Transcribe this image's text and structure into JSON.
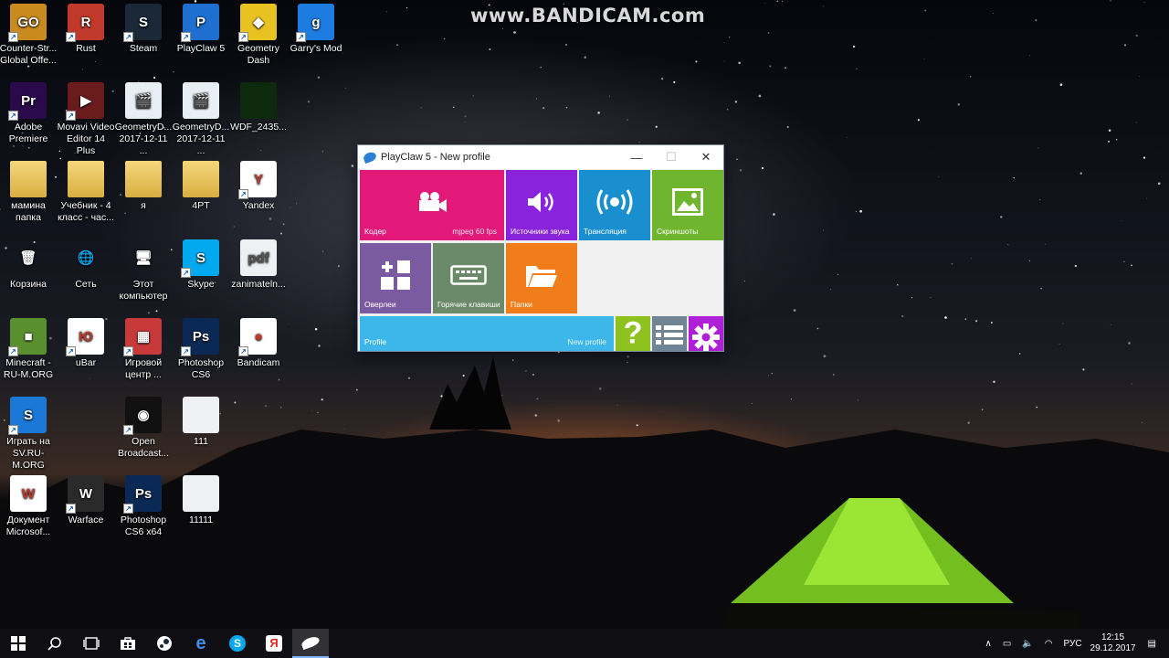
{
  "watermark": "www.BANDICAM.com",
  "desktop": {
    "icons": [
      {
        "label": "Counter-Str... Global Offe...",
        "glyph": "GO",
        "color": "#c98a1e",
        "shortcut": true
      },
      {
        "label": "Rust",
        "glyph": "R",
        "color": "#c0392b",
        "shortcut": true
      },
      {
        "label": "Steam",
        "glyph": "S",
        "color": "#1b2838",
        "shortcut": true
      },
      {
        "label": "PlayClaw 5",
        "glyph": "P",
        "color": "#1e6fd0",
        "shortcut": true
      },
      {
        "label": "Geometry Dash",
        "glyph": "◆",
        "color": "#e8c220",
        "shortcut": true
      },
      {
        "label": "Garry's Mod",
        "glyph": "g",
        "color": "#1d7ce0",
        "shortcut": true
      },
      {
        "label": "Adobe Premiere",
        "glyph": "Pr",
        "color": "#2a0a4a",
        "shortcut": true
      },
      {
        "label": "Movavi Video Editor 14 Plus",
        "glyph": "▶",
        "color": "#6a1c1c",
        "shortcut": true
      },
      {
        "label": "GeometryD... 2017-12-11 ...",
        "glyph": "🎬",
        "color": "#e8eef5",
        "shortcut": false
      },
      {
        "label": "GeometryD... 2017-12-11 ...",
        "glyph": "🎬",
        "color": "#e8eef5",
        "shortcut": false
      },
      {
        "label": "WDF_2435...",
        "glyph": "",
        "color": "#0d2a0d",
        "shortcut": false
      },
      {
        "label": "мамина папка",
        "glyph": "",
        "color": "folder",
        "shortcut": false
      },
      {
        "label": "Учебник - 4 класс - час...",
        "glyph": "",
        "color": "folder",
        "shortcut": false
      },
      {
        "label": "я",
        "glyph": "",
        "color": "folder",
        "shortcut": false
      },
      {
        "label": "4PT",
        "glyph": "",
        "color": "folder",
        "shortcut": false
      },
      {
        "label": "Yandex",
        "glyph": "Y",
        "color": "#ffffff",
        "shortcut": true
      },
      {
        "label": "Корзина",
        "glyph": "🗑",
        "color": "transparent",
        "shortcut": false
      },
      {
        "label": "Сеть",
        "glyph": "🌐",
        "color": "transparent",
        "shortcut": false
      },
      {
        "label": "Этот компьютер",
        "glyph": "🖥",
        "color": "transparent",
        "shortcut": false
      },
      {
        "label": "Skype",
        "glyph": "S",
        "color": "#00a9f0",
        "shortcut": true
      },
      {
        "label": "zanimateln...",
        "glyph": "pdf",
        "color": "paper",
        "shortcut": false
      },
      {
        "label": "Minecraft - RU-M.ORG",
        "glyph": "■",
        "color": "#5a8f2f",
        "shortcut": true
      },
      {
        "label": "uBar",
        "glyph": "Ю",
        "color": "#ffffff",
        "shortcut": true
      },
      {
        "label": "Игровой центр ...",
        "glyph": "▦",
        "color": "#c83a3a",
        "shortcut": true
      },
      {
        "label": "Photoshop CS6",
        "glyph": "Ps",
        "color": "#0a2a55",
        "shortcut": true
      },
      {
        "label": "Bandicam",
        "glyph": "●",
        "color": "#ffffff",
        "shortcut": true
      },
      {
        "label": "Играть на SV.RU-M.ORG",
        "glyph": "S",
        "color": "#1c78d6",
        "shortcut": true
      },
      {
        "label": "Open Broadcast...",
        "glyph": "◉",
        "color": "#111111",
        "shortcut": true
      },
      {
        "label": "111",
        "glyph": "",
        "color": "paper",
        "shortcut": false
      },
      {
        "label": "Документ Microsof...",
        "glyph": "W",
        "color": "#ffffff",
        "shortcut": false
      },
      {
        "label": "Warface",
        "glyph": "W",
        "color": "#2a2a2a",
        "shortcut": true
      },
      {
        "label": "Photoshop CS6 x64",
        "glyph": "Ps",
        "color": "#0a2a55",
        "shortcut": true
      },
      {
        "label": "11111",
        "glyph": "",
        "color": "paper",
        "shortcut": false
      }
    ]
  },
  "window": {
    "title": "PlayClaw 5 - New profile",
    "minimize": "—",
    "maximize": "☐",
    "close": "✕",
    "tiles": {
      "encoder": {
        "label": "Кодер",
        "sub": "mjpeg 60 fps",
        "color": "#e3197a"
      },
      "audio": {
        "label": "Источники звука",
        "color": "#8a23dc"
      },
      "stream": {
        "label": "Трансляция",
        "color": "#1a8fd0"
      },
      "screenshots": {
        "label": "Скриншоты",
        "color": "#6fb52d"
      },
      "overlays": {
        "label": "Оверлеи",
        "color": "#7a5aa0"
      },
      "hotkeys": {
        "label": "Горячие клавиши",
        "color": "#6b8a6a"
      },
      "folders": {
        "label": "Папки",
        "color": "#f07c1a"
      },
      "profile": {
        "label": "Profile",
        "sub": "New profile",
        "color": "#3db7ea"
      },
      "help": {
        "glyph": "?",
        "color": "#8ec21f"
      },
      "list": {
        "color": "#6f8595"
      },
      "settings": {
        "color": "#b01fd8"
      }
    }
  },
  "taskbar": {
    "items": [
      "start",
      "search",
      "taskview",
      "store",
      "steam",
      "edge",
      "skype",
      "yandex",
      "playclaw"
    ],
    "lang": "РУС",
    "time": "12:15",
    "date": "29.12.2017"
  }
}
